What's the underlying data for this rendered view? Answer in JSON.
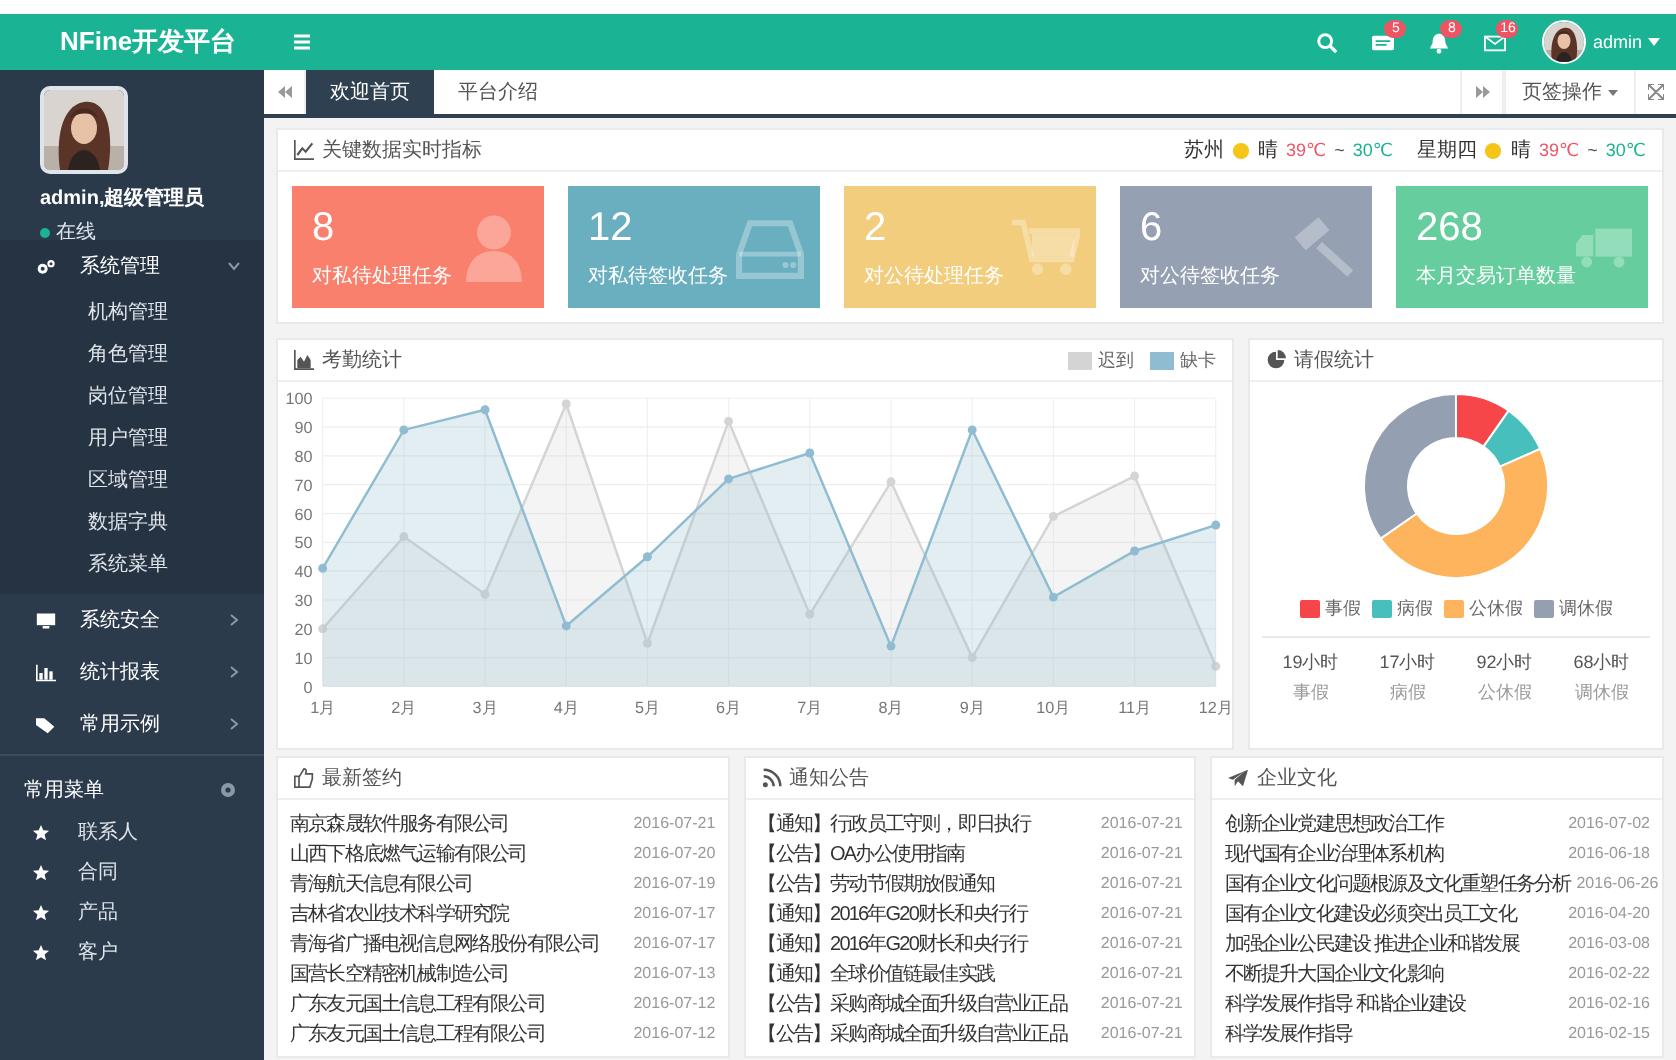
{
  "app": {
    "title": "NFine开发平台"
  },
  "top_bar": {
    "badges": [
      {
        "kind": "tasks",
        "count": "5"
      },
      {
        "kind": "bell",
        "count": "8"
      },
      {
        "kind": "mail",
        "count": "16"
      }
    ],
    "user": "admin"
  },
  "profile": {
    "name": "admin,超级管理员",
    "status": "在线"
  },
  "sidebar": {
    "items": [
      {
        "label": "系统管理",
        "kind": "gears",
        "expanded": true,
        "children": [
          {
            "label": "机构管理"
          },
          {
            "label": "角色管理"
          },
          {
            "label": "岗位管理"
          },
          {
            "label": "用户管理"
          },
          {
            "label": "区域管理"
          },
          {
            "label": "数据字典"
          },
          {
            "label": "系统菜单"
          }
        ]
      },
      {
        "label": "系统安全",
        "kind": "monitor",
        "expanded": false
      },
      {
        "label": "统计报表",
        "kind": "bars",
        "expanded": false
      },
      {
        "label": "常用示例",
        "kind": "tag",
        "expanded": false
      }
    ]
  },
  "shortcuts": {
    "title": "常用菜单",
    "items": [
      {
        "label": "联系人"
      },
      {
        "label": "合同"
      },
      {
        "label": "产品"
      },
      {
        "label": "客户"
      }
    ]
  },
  "tabs": [
    {
      "label": "欢迎首页",
      "selected": true
    },
    {
      "label": "平台介绍",
      "selected": false
    }
  ],
  "tab_actions": {
    "label": "页签操作"
  },
  "metrics": {
    "title": "关键数据实时指标",
    "weather": [
      {
        "label": "苏州",
        "condition": "晴",
        "high": "39℃",
        "separator": "~",
        "low": "30℃"
      },
      {
        "label": "星期四",
        "condition": "晴",
        "high": "39℃",
        "separator": "~",
        "low": "30℃"
      }
    ],
    "cards": [
      {
        "value": "8",
        "label": "对私待处理任务",
        "kind": "user",
        "color": "#f9806c"
      },
      {
        "value": "12",
        "label": "对私待签收任务",
        "kind": "drive",
        "color": "#6aafbf"
      },
      {
        "value": "2",
        "label": "对公待处理任务",
        "kind": "cart",
        "color": "#f3cd7e"
      },
      {
        "value": "6",
        "label": "对公待签收任务",
        "kind": "gavel",
        "color": "#96a0b3"
      },
      {
        "value": "268",
        "label": "本月交易订单数量",
        "kind": "truck",
        "color": "#66ce9e"
      }
    ]
  },
  "attendance": {
    "title": "考勤统计",
    "chart_data": {
      "type": "area",
      "grid": true,
      "categories": [
        "1月",
        "2月",
        "3月",
        "4月",
        "5月",
        "6月",
        "7月",
        "8月",
        "9月",
        "10月",
        "11月",
        "12月"
      ],
      "ylim": [
        0,
        100
      ],
      "yticks": [
        0,
        10,
        20,
        30,
        40,
        50,
        60,
        70,
        80,
        90,
        100
      ],
      "series": [
        {
          "name": "迟到",
          "color": "#d4d4d4",
          "values": [
            20,
            52,
            32,
            98,
            15,
            92,
            25,
            71,
            10,
            59,
            73,
            7
          ]
        },
        {
          "name": "缺卡",
          "color": "#8fbcd0",
          "values": [
            41,
            89,
            96,
            21,
            45,
            72,
            81,
            14,
            89,
            31,
            47,
            56
          ]
        }
      ]
    }
  },
  "leave": {
    "title": "请假统计",
    "chart_data": {
      "type": "donut",
      "categories": [
        "事假",
        "病假",
        "公休假",
        "调休假"
      ],
      "values": [
        9.7,
        8.7,
        46.9,
        34.7
      ],
      "colors": [
        "#f7464a",
        "#46bfbd",
        "#fdb45c",
        "#949fb1"
      ]
    },
    "totals": [
      {
        "value": "19小时",
        "label": "事假"
      },
      {
        "value": "17小时",
        "label": "病假"
      },
      {
        "value": "92小时",
        "label": "公休假"
      },
      {
        "value": "68小时",
        "label": "调休假"
      }
    ]
  },
  "lists": [
    {
      "title": "最新签约",
      "kind": "thumb",
      "rows": [
        {
          "text": "南京森晟软件服务有限公司",
          "date": "2016-07-21"
        },
        {
          "text": "山西下格底燃气运输有限公司",
          "date": "2016-07-20"
        },
        {
          "text": "青海航天信息有限公司",
          "date": "2016-07-19"
        },
        {
          "text": "吉林省农业技术科学研究院",
          "date": "2016-07-17"
        },
        {
          "text": "青海省广播电视信息网络股份有限公司",
          "date": "2016-07-17"
        },
        {
          "text": "国营长空精密机械制造公司",
          "date": "2016-07-13"
        },
        {
          "text": "广东友元国土信息工程有限公司",
          "date": "2016-07-12"
        },
        {
          "text": "广东友元国土信息工程有限公司",
          "date": "2016-07-12"
        }
      ]
    },
    {
      "title": "通知公告",
      "kind": "rss",
      "rows": [
        {
          "text": "【通知】行政员工守则，即日执行",
          "date": "2016-07-21"
        },
        {
          "text": "【公告】OA办公使用指南",
          "date": "2016-07-21"
        },
        {
          "text": "【公告】劳动节假期放假通知",
          "date": "2016-07-21"
        },
        {
          "text": "【通知】2016年G20财长和央行行",
          "date": "2016-07-21"
        },
        {
          "text": "【通知】2016年G20财长和央行行",
          "date": "2016-07-21"
        },
        {
          "text": "【通知】全球价值链最佳实践",
          "date": "2016-07-21"
        },
        {
          "text": "【公告】采购商城全面升级自营业正品",
          "date": "2016-07-21"
        },
        {
          "text": "【公告】采购商城全面升级自营业正品",
          "date": "2016-07-21"
        }
      ]
    },
    {
      "title": "企业文化",
      "kind": "plane",
      "rows": [
        {
          "text": "创新企业党建思想政治工作",
          "date": "2016-07-02"
        },
        {
          "text": "现代国有企业治理体系机构",
          "date": "2016-06-18"
        },
        {
          "text": "国有企业文化问题根源及文化重塑任务分析",
          "date": "2016-06-26"
        },
        {
          "text": "国有企业文化建设必须突出员工文化",
          "date": "2016-04-20"
        },
        {
          "text": "加强企业公民建设 推进企业和谐发展",
          "date": "2016-03-08"
        },
        {
          "text": "不断提升大国企业文化影响",
          "date": "2016-02-22"
        },
        {
          "text": "科学发展作指导 和谐企业建设",
          "date": "2016-02-16"
        },
        {
          "text": "科学发展作指导",
          "date": "2016-02-15"
        }
      ]
    }
  ]
}
